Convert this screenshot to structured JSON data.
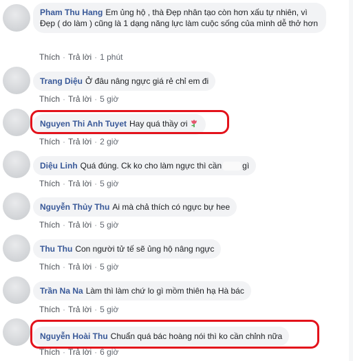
{
  "actions": {
    "like": "Thích",
    "reply": "Trả lời"
  },
  "comments": [
    {
      "name": "Pham Thu Hang",
      "text": "Em ủng hộ , thà Đẹp nhân tạo còn hơn xấu tự nhiên, vì Đẹp ( do làm ) cũng là 1 dạng năng lực làm cuộc sống của mình dễ thở hơn",
      "time": "1 phút"
    },
    {
      "name": "Trang Diệu",
      "text": "Ở đâu nâng ngực giá rẻ chỉ em đi",
      "time": "5 giờ"
    },
    {
      "name": "Nguyen Thi Anh Tuyet",
      "text": "Hay quá thầy ơi",
      "emoji": "tulip-icon",
      "time": "2 giờ"
    },
    {
      "name": "Diệu Linh",
      "text_before": "Quá đúng. Ck ko cho làm ngực thì cần",
      "text_after": "gì",
      "time": "5 giờ"
    },
    {
      "name": "Nguyễn Thủy Thu",
      "text": "Ai mà chả thích có ngực bự hee",
      "time": "5 giờ"
    },
    {
      "name": "Thu Thu",
      "text": "Con người tử tế sẽ ủng hộ nâng ngực",
      "time": "5 giờ"
    },
    {
      "name": "Trần Na Na",
      "text": "Làm thì làm chứ lo gì mồm thiên hạ Hà bác",
      "time": "5 giờ"
    },
    {
      "name": "Nguyễn Hoài Thu",
      "text": "Chuẩn quá bác hoàng nói thì ko cần chỉnh nữa",
      "time": "6 giờ"
    }
  ],
  "colors": {
    "highlight": "#e3121b",
    "name": "#385898",
    "bubble": "#f2f3f5"
  }
}
